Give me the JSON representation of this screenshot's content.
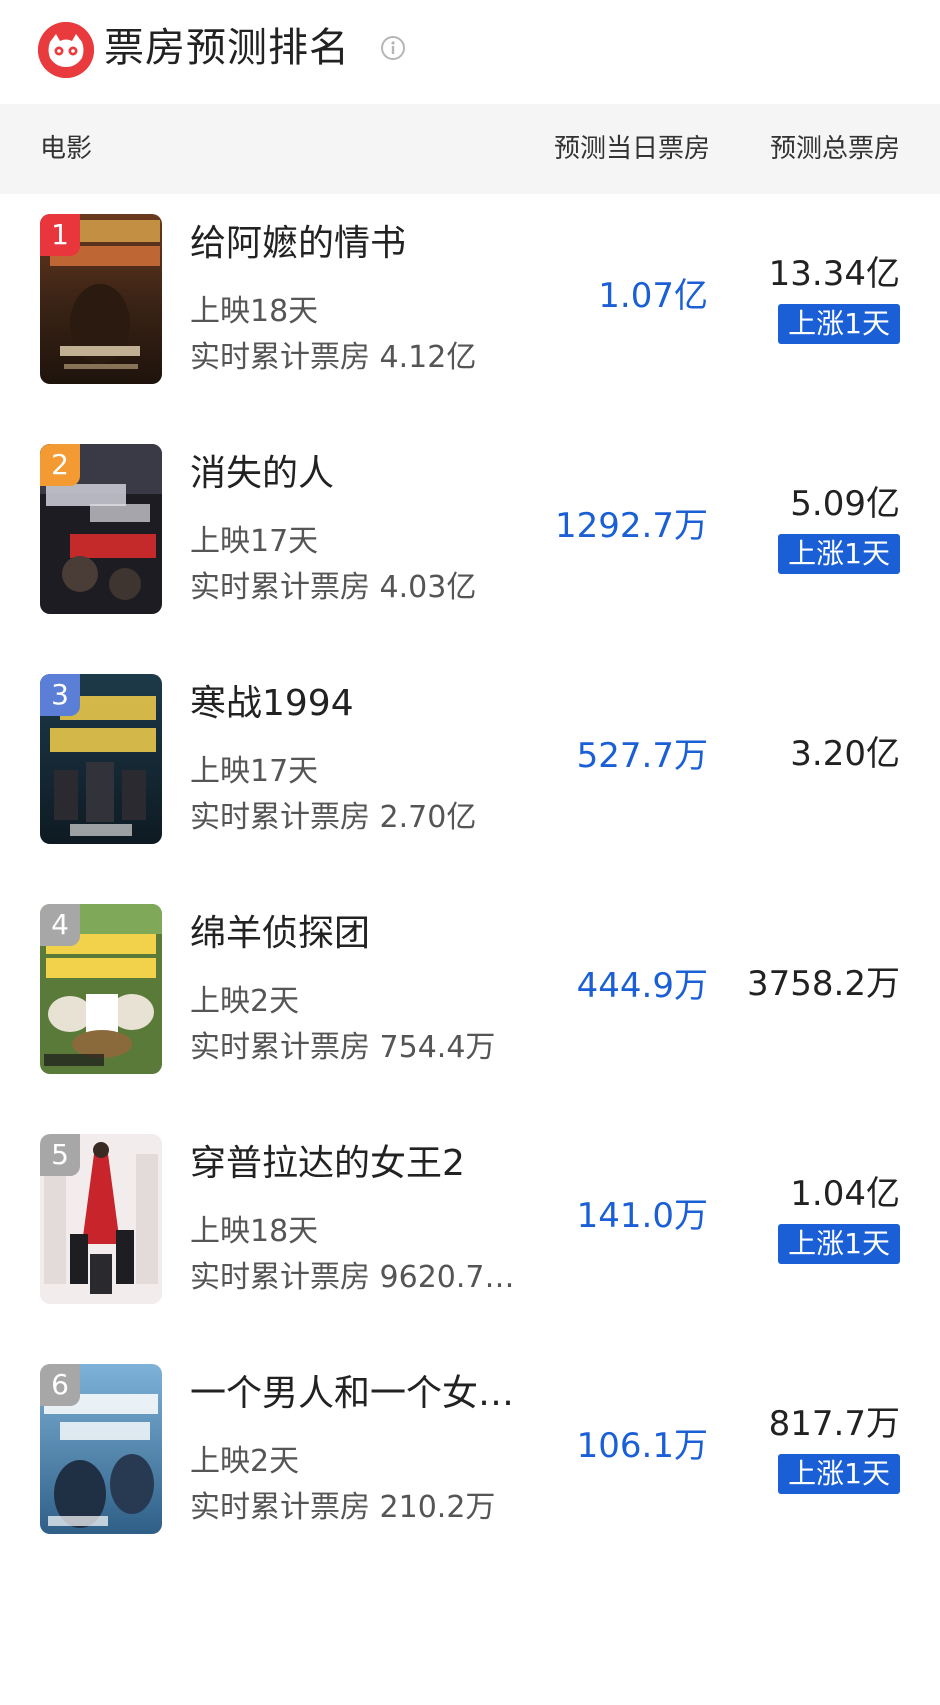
{
  "header": {
    "title": "票房预测排名",
    "info_icon": "info-circle-icon",
    "logo_icon": "cat-eye-logo-icon"
  },
  "columns": {
    "movie": "电影",
    "day_forecast": "预测当日票房",
    "total_forecast": "预测总票房"
  },
  "colors": {
    "accent_blue": "#1a5fd6",
    "logo_red": "#e93b3d",
    "rank_1": "#e9363c",
    "rank_2": "#f39b32",
    "rank_3": "#5b7fd6",
    "rank_other": "#a7a7a7"
  },
  "movies": [
    {
      "rank": "1",
      "name": "给阿嬷的情书",
      "days": "上映18天",
      "cumulative": "实时累计票房 4.12亿",
      "day_forecast": "1.07亿",
      "total_forecast": "13.34亿",
      "tag": "上涨1天"
    },
    {
      "rank": "2",
      "name": "消失的人",
      "days": "上映17天",
      "cumulative": "实时累计票房 4.03亿",
      "day_forecast": "1292.7万",
      "total_forecast": "5.09亿",
      "tag": "上涨1天"
    },
    {
      "rank": "3",
      "name": "寒战1994",
      "days": "上映17天",
      "cumulative": "实时累计票房 2.70亿",
      "day_forecast": "527.7万",
      "total_forecast": "3.20亿",
      "tag": ""
    },
    {
      "rank": "4",
      "name": "绵羊侦探团",
      "days": "上映2天",
      "cumulative": "实时累计票房 754.4万",
      "day_forecast": "444.9万",
      "total_forecast": "3758.2万",
      "tag": ""
    },
    {
      "rank": "5",
      "name": "穿普拉达的女王2",
      "days": "上映18天",
      "cumulative": "实时累计票房 9620.7…",
      "day_forecast": "141.0万",
      "total_forecast": "1.04亿",
      "tag": "上涨1天"
    },
    {
      "rank": "6",
      "name": "一个男人和一个女…",
      "days": "上映2天",
      "cumulative": "实时累计票房 210.2万",
      "day_forecast": "106.1万",
      "total_forecast": "817.7万",
      "tag": "上涨1天"
    }
  ]
}
